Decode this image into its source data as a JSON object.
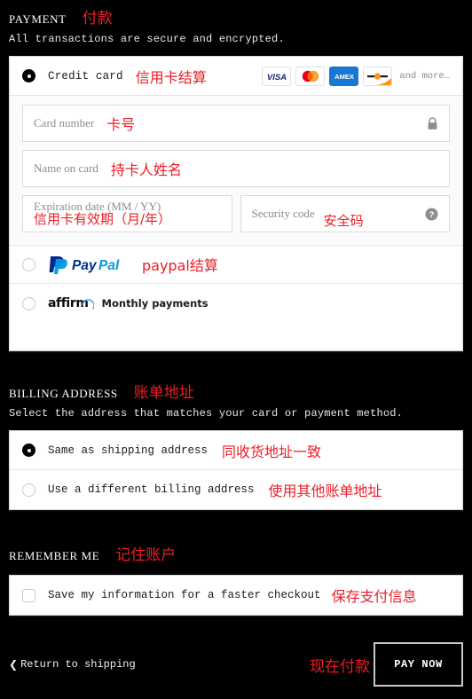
{
  "payment": {
    "title": "PAYMENT",
    "title_cn": "付款",
    "subtitle": "All transactions are secure and encrypted.",
    "methods": [
      {
        "id": "credit-card",
        "label": "Credit card",
        "label_cn": "信用卡结算",
        "selected": true,
        "brands": [
          "visa",
          "mastercard",
          "amex",
          "discover"
        ],
        "and_more": "and more…"
      },
      {
        "id": "paypal",
        "label": "PayPal",
        "label_cn": "paypal结算",
        "selected": false
      },
      {
        "id": "affirm",
        "label": "affirm",
        "label_sub": "Monthly payments",
        "selected": false
      }
    ],
    "fields": {
      "card_number": {
        "label": "Card number",
        "label_cn": "卡号",
        "value": "",
        "icon": "lock-icon"
      },
      "name_on_card": {
        "label": "Name on card",
        "label_cn": "持卡人姓名",
        "value": ""
      },
      "expiration": {
        "label": "Expiration date (MM / YY)",
        "label_cn": "信用卡有效期（月/年）",
        "value": ""
      },
      "security_code": {
        "label": "Security code",
        "label_cn": "安全码",
        "value": "",
        "icon": "help-circle-icon"
      }
    }
  },
  "billing": {
    "title": "BILLING ADDRESS",
    "title_cn": "账单地址",
    "subtitle": "Select the address that matches your card or payment method.",
    "options": [
      {
        "id": "same-as-shipping",
        "label": "Same as shipping address",
        "label_cn": "同收货地址一致",
        "selected": true
      },
      {
        "id": "different-billing",
        "label": "Use a different billing address",
        "label_cn": "使用其他账单地址",
        "selected": false
      }
    ]
  },
  "remember": {
    "title": "REMEMBER ME",
    "title_cn": "记住账户",
    "checkbox": {
      "label": "Save my information for a faster checkout",
      "label_cn": "保存支付信息",
      "checked": false
    }
  },
  "footer": {
    "return_link": "Return to shipping",
    "return_chevron": "❮",
    "pay_button": "PAY NOW",
    "pay_button_cn": "现在付款"
  },
  "colors": {
    "background": "#000000",
    "card": "#ffffff",
    "annotation": "#ee1c25",
    "text": "#ffffff"
  }
}
